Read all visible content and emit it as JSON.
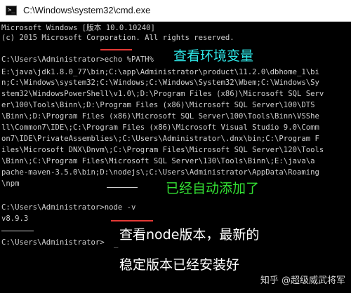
{
  "window": {
    "title": "C:\\Windows\\system32\\cmd.exe",
    "icon": "cmd-icon"
  },
  "console": {
    "lines": [
      "Microsoft Windows [版本 10.0.10240]",
      "(c) 2015 Microsoft Corporation. All rights reserved.",
      "",
      "C:\\Users\\Administrator>echo %PATH%",
      "E:\\java\\jdk1.8.0_77\\bin;C:\\app\\Administrator\\product\\11.2.0\\dbhome_1\\bi",
      "n;C:\\Windows\\system32;C:\\Windows;C:\\Windows\\System32\\Wbem;C:\\Windows\\Sy",
      "stem32\\WindowsPowerShell\\v1.0\\;D:\\Program Files (x86)\\Microsoft SQL Serv",
      "er\\100\\Tools\\Binn\\;D:\\Program Files (x86)\\Microsoft SQL Server\\100\\DTS",
      "\\Binn\\;D:\\Program Files (x86)\\Microsoft SQL Server\\100\\Tools\\Binn\\VSShe",
      "ll\\Common7\\IDE\\;C:\\Program Files (x86)\\Microsoft Visual Studio 9.0\\Comm",
      "on7\\IDE\\PrivateAssemblies\\;C:\\Users\\Administrator\\.dnx\\bin;C:\\Program F",
      "iles\\Microsoft DNX\\Dnvm\\;C:\\Program Files\\Microsoft SQL Server\\120\\Tools",
      "\\Binn\\;C:\\Program Files\\Microsoft SQL Server\\130\\Tools\\Binn\\;E:\\java\\a",
      "pache-maven-3.5.0\\bin;D:\\nodejs\\;C:\\Users\\Administrator\\AppData\\Roaming",
      "\\npm",
      "",
      "C:\\Users\\Administrator>node -v",
      "v8.9.3",
      "",
      "C:\\Users\\Administrator>"
    ],
    "cursor": "_"
  },
  "annotations": {
    "check_env": "查看环境变量",
    "auto_added": "已经自动添加了",
    "check_node_line1": "查看node版本，最新的",
    "check_node_line2": "稳定版本已经安装好"
  },
  "colors": {
    "console_bg": "#000000",
    "console_text": "#cfcfcf",
    "annotation_cyan": "#2ee6e6",
    "annotation_green": "#33e033",
    "annotation_white": "#ffffff",
    "mark_red": "#e53935"
  },
  "watermark": "知乎 @超级威武将军"
}
